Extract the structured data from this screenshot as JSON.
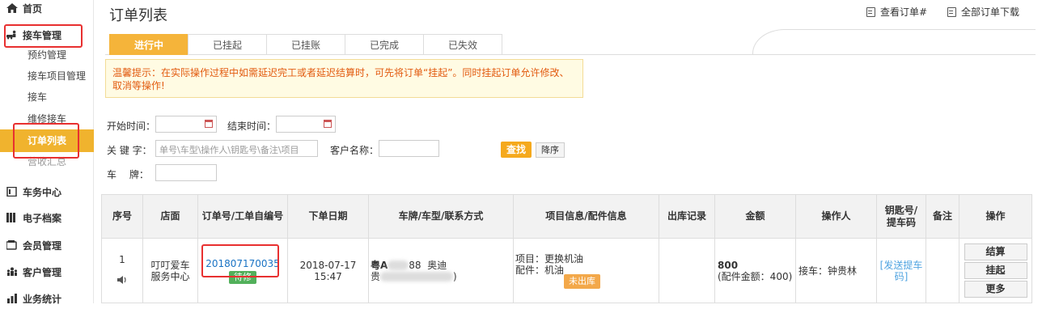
{
  "sidebar": {
    "items": [
      {
        "label": "首页",
        "icon": "home-icon",
        "type": "main"
      },
      {
        "label": "接车管理",
        "icon": "car-person-icon",
        "type": "main"
      },
      {
        "label": "预约管理",
        "type": "sub"
      },
      {
        "label": "接车项目管理",
        "type": "sub"
      },
      {
        "label": "接车",
        "type": "sub"
      },
      {
        "label": "维修接车",
        "type": "sub"
      },
      {
        "label": "订单列表",
        "type": "sub",
        "active": true
      },
      {
        "label": "营收汇总",
        "type": "sub"
      },
      {
        "label": "车务中心",
        "icon": "clipboard-icon",
        "type": "main"
      },
      {
        "label": "电子档案",
        "icon": "archive-icon",
        "type": "main"
      },
      {
        "label": "会员管理",
        "icon": "member-icon",
        "type": "main"
      },
      {
        "label": "客户管理",
        "icon": "customers-icon",
        "type": "main"
      },
      {
        "label": "业务统计",
        "icon": "stats-icon",
        "type": "main"
      }
    ]
  },
  "header": {
    "title": "订单列表",
    "view_order": "查看订单#",
    "download_all": "全部订单下载"
  },
  "tabs": [
    "进行中",
    "已挂起",
    "已挂账",
    "已完成",
    "已失效"
  ],
  "notice": "温馨提示：在实际操作过程中如需延迟完工或者延迟结算时，可先将订单“挂起”。同时挂起订单允许修改、取消等操作!",
  "filters": {
    "start_label": "开始时间：",
    "end_label": "结束时间：",
    "keyword_label": "关 键 字：",
    "keyword_placeholder": "单号\\车型\\操作人\\钥匙号\\备注\\项目",
    "customer_label": "客户名称：",
    "plate_label": "车　 牌：",
    "search_button": "查找",
    "reset_button": "降序"
  },
  "table": {
    "headers": [
      "序号",
      "店面",
      "订单号/工单自编号",
      "下单日期",
      "车牌/车型/联系方式",
      "项目信息/配件信息",
      "出库记录",
      "金额",
      "操作人",
      "钥匙号/提车码",
      "备注",
      "操作"
    ],
    "rows": [
      {
        "index": "1",
        "store": "叮叮爱车服务中心",
        "order_no": "201807170035",
        "order_tag": "待修",
        "date": "2018-07-17",
        "time": "15:47",
        "plate_prefix": "粤A",
        "plate_suffix": "88",
        "car_model": "奥迪",
        "contact_prefix": "贵",
        "contact_suffix": ")",
        "project": "项目：更换机油",
        "parts": "配件：机油",
        "stock_tag": "未出库",
        "amount": "800",
        "amount_detail": "(配件金额：400)",
        "operator": "接车：钟贵林",
        "key_code": "[发送提车码]",
        "remark": "",
        "actions": [
          "结算",
          "挂起",
          "更多"
        ]
      }
    ]
  },
  "colors": {
    "accent": "#f5b43a",
    "highlight_box": "#e83030",
    "link": "#1a73c4"
  }
}
